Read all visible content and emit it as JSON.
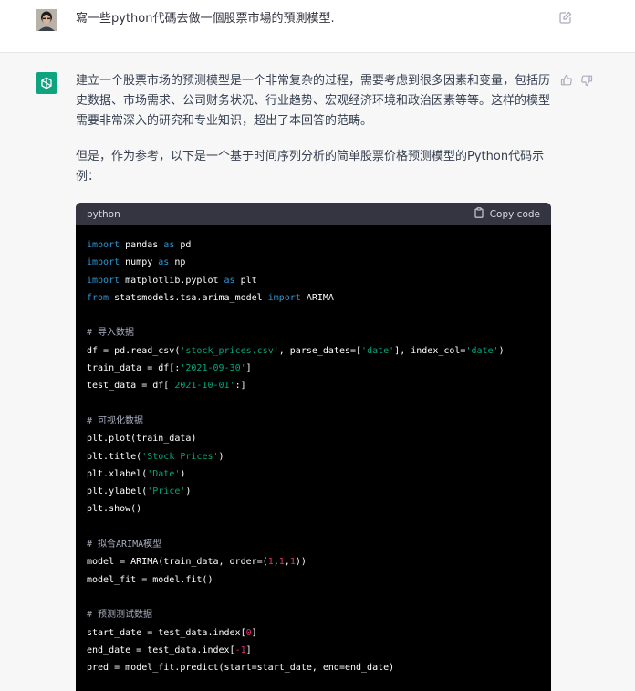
{
  "user_message": {
    "text": "寫一些python代碼去做一個股票市場的預測模型."
  },
  "assistant": {
    "paragraph1": "建立一个股票市场的预测模型是一个非常复杂的过程，需要考虑到很多因素和变量，包括历史数据、市场需求、公司财务状况、行业趋势、宏观经济环境和政治因素等等。这样的模型需要非常深入的研究和专业知识，超出了本回答的范畴。",
    "paragraph2": "但是，作为参考，以下是一个基于时间序列分析的简单股票价格预测模型的Python代码示例：",
    "code": {
      "language": "python",
      "copy_label": "Copy code",
      "lines": [
        [
          [
            "kw",
            "import"
          ],
          [
            "t",
            " pandas "
          ],
          [
            "kw",
            "as"
          ],
          [
            "t",
            " pd"
          ]
        ],
        [
          [
            "kw",
            "import"
          ],
          [
            "t",
            " numpy "
          ],
          [
            "kw",
            "as"
          ],
          [
            "t",
            " np"
          ]
        ],
        [
          [
            "kw",
            "import"
          ],
          [
            "t",
            " matplotlib.pyplot "
          ],
          [
            "kw",
            "as"
          ],
          [
            "t",
            " plt"
          ]
        ],
        [
          [
            "kw",
            "from"
          ],
          [
            "t",
            " statsmodels.tsa.arima_model "
          ],
          [
            "kw",
            "import"
          ],
          [
            "t",
            " ARIMA"
          ]
        ],
        [],
        [
          [
            "cm",
            "# 导入数据"
          ]
        ],
        [
          [
            "t",
            "df = pd.read_csv("
          ],
          [
            "str",
            "'stock_prices.csv'"
          ],
          [
            "t",
            ", parse_dates=["
          ],
          [
            "str",
            "'date'"
          ],
          [
            "t",
            "], index_col="
          ],
          [
            "str",
            "'date'"
          ],
          [
            "t",
            ")"
          ]
        ],
        [
          [
            "t",
            "train_data = df[:"
          ],
          [
            "str",
            "'2021-09-30'"
          ],
          [
            "t",
            "]"
          ]
        ],
        [
          [
            "t",
            "test_data = df["
          ],
          [
            "str",
            "'2021-10-01'"
          ],
          [
            "t",
            ":]"
          ]
        ],
        [],
        [
          [
            "cm",
            "# 可视化数据"
          ]
        ],
        [
          [
            "t",
            "plt.plot(train_data)"
          ]
        ],
        [
          [
            "t",
            "plt.title("
          ],
          [
            "str",
            "'Stock Prices'"
          ],
          [
            "t",
            ")"
          ]
        ],
        [
          [
            "t",
            "plt.xlabel("
          ],
          [
            "str",
            "'Date'"
          ],
          [
            "t",
            ")"
          ]
        ],
        [
          [
            "t",
            "plt.ylabel("
          ],
          [
            "str",
            "'Price'"
          ],
          [
            "t",
            ")"
          ]
        ],
        [
          [
            "t",
            "plt.show()"
          ]
        ],
        [],
        [
          [
            "cm",
            "# 拟合ARIMA模型"
          ]
        ],
        [
          [
            "t",
            "model = ARIMA(train_data, order=("
          ],
          [
            "num",
            "1"
          ],
          [
            "t",
            ","
          ],
          [
            "num",
            "1"
          ],
          [
            "t",
            ","
          ],
          [
            "num",
            "1"
          ],
          [
            "t",
            "))"
          ]
        ],
        [
          [
            "t",
            "model_fit = model.fit()"
          ]
        ],
        [],
        [
          [
            "cm",
            "# 预测测试数据"
          ]
        ],
        [
          [
            "t",
            "start_date = test_data.index["
          ],
          [
            "num",
            "0"
          ],
          [
            "t",
            "]"
          ]
        ],
        [
          [
            "t",
            "end_date = test_data.index["
          ],
          [
            "num",
            "-1"
          ],
          [
            "t",
            "]"
          ]
        ],
        [
          [
            "t",
            "pred = model_fit.predict(start=start_date, end=end_date)"
          ]
        ]
      ]
    }
  },
  "colors": {
    "bot_avatar": "#10a37f",
    "code_bg": "#000000",
    "code_header": "#343541",
    "keyword": "#2e95d3",
    "string": "#00a67d",
    "number": "#df3079",
    "comment": "#a9aec1"
  },
  "icons": {
    "edit": "edit-icon",
    "thumbs_up": "thumbs-up-icon",
    "thumbs_down": "thumbs-down-icon",
    "copy": "clipboard-icon",
    "assistant_logo": "openai-logo-icon"
  }
}
